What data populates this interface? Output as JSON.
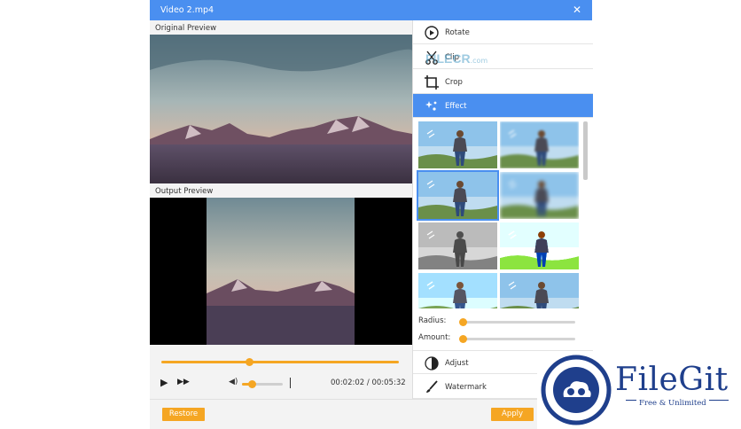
{
  "window": {
    "title": "Video 2.mp4"
  },
  "preview": {
    "original_label": "Original Preview",
    "output_label": "Output Preview"
  },
  "player": {
    "time_current": "00:02:02",
    "time_separator": "/",
    "time_total": "00:05:32",
    "progress": 0.37,
    "volume": 0.25
  },
  "menu": {
    "rotate": "Rotate",
    "clip": "Clip",
    "crop": "Crop",
    "effect": "Effect",
    "adjust": "Adjust",
    "watermark": "Watermark"
  },
  "effects": {
    "radius_label": "Radius:",
    "amount_label": "Amount:",
    "radius_value": 0,
    "amount_value": 0,
    "selected_index": 2
  },
  "buttons": {
    "restore": "Restore",
    "apply": "Apply"
  },
  "watermarks": {
    "filecr": "FILECR",
    "filecr_suffix": ".com",
    "filegit": "FileGit",
    "filegit_tagline": "Free & Unlimited"
  },
  "colors": {
    "accent": "#4a8ff0",
    "orange": "#f5a623"
  }
}
